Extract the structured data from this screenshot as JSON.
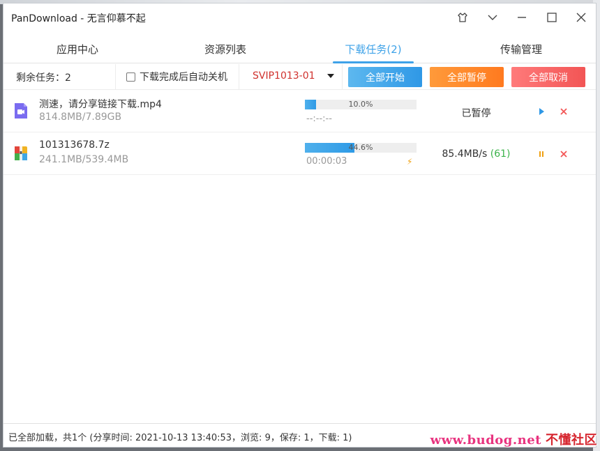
{
  "window": {
    "title": "PanDownload - 无言仰慕不起"
  },
  "tabs": [
    {
      "label": "应用中心",
      "active": false
    },
    {
      "label": "资源列表",
      "active": false
    },
    {
      "label": "下载任务(2)",
      "active": true
    },
    {
      "label": "传输管理",
      "active": false
    }
  ],
  "toolbar": {
    "remaining": "剩余任务：2",
    "auto_shutdown_label": "下载完成后自动关机",
    "auto_shutdown_checked": false,
    "server_selected": "SVIP1013-01",
    "start_all": "全部开始",
    "pause_all": "全部暂停",
    "cancel_all": "全部取消"
  },
  "tasks": [
    {
      "name": "测速，请分享链接下载.mp4",
      "size": "814.8MB/7.89GB",
      "progress": 0.1,
      "progress_label": "10.0%",
      "time_left": "--:--:--",
      "status": "已暂停",
      "icon": "video-file-icon",
      "action_primary": "play-icon"
    },
    {
      "name": "101313678.7z",
      "size": "241.1MB/539.4MB",
      "progress": 0.446,
      "progress_label": "44.6%",
      "time_left": "00:00:03",
      "speed": "85.4MB/s",
      "connections": "(61)",
      "icon": "archive-file-icon",
      "action_primary": "pause-icon"
    }
  ],
  "statusbar": {
    "info": "已全部加载，共1个 (分享时间: 2021-10-13 13:40:53，浏览: 9，保存: 1，下载: 1)"
  },
  "watermark": {
    "site": "www.budog.net",
    "name": "不懂社区"
  },
  "colors": {
    "accent": "#3ea2e8",
    "start": "#2f98e6",
    "pause": "#ff7a1f",
    "cancel": "#f25555",
    "server_text": "#d0312d",
    "speed_green": "#3bb34a"
  }
}
